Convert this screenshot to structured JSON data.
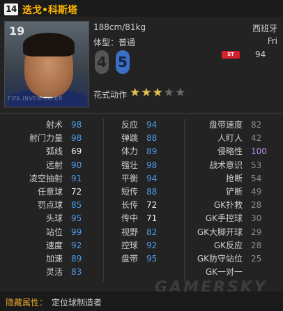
{
  "header": {
    "season_badge": "14",
    "player_name": "迭戈•科斯塔"
  },
  "portrait": {
    "overall": "19",
    "watermark": "FIFA.INVEN.CO.KR"
  },
  "info": {
    "height_weight": "188cm/81kg",
    "body_type": "体型：普通",
    "nation": "西班牙",
    "club": "Fri",
    "position_badge": "ST",
    "position_rating": "94",
    "weak_foot": "4",
    "strong_foot": "5",
    "skill_moves_label": "花式动作",
    "skill_stars": 3,
    "skill_stars_max": 5
  },
  "stats": {
    "col1": [
      {
        "name": "射术",
        "value": "98",
        "color": "blue"
      },
      {
        "name": "射门力量",
        "value": "98",
        "color": "blue"
      },
      {
        "name": "弧线",
        "value": "69",
        "color": "white"
      },
      {
        "name": "远射",
        "value": "90",
        "color": "blue"
      },
      {
        "name": "凌空抽射",
        "value": "91",
        "color": "blue"
      },
      {
        "name": "任意球",
        "value": "72",
        "color": "white"
      },
      {
        "name": "罚点球",
        "value": "85",
        "color": "blue"
      },
      {
        "name": "头球",
        "value": "95",
        "color": "blue"
      },
      {
        "name": "站位",
        "value": "99",
        "color": "blue"
      },
      {
        "name": "速度",
        "value": "92",
        "color": "blue"
      },
      {
        "name": "加速",
        "value": "89",
        "color": "blue"
      },
      {
        "name": "灵活",
        "value": "83",
        "color": "blue"
      }
    ],
    "col2": [
      {
        "name": "反应",
        "value": "94",
        "color": "blue"
      },
      {
        "name": "弹跳",
        "value": "88",
        "color": "blue"
      },
      {
        "name": "体力",
        "value": "89",
        "color": "blue"
      },
      {
        "name": "强壮",
        "value": "98",
        "color": "blue"
      },
      {
        "name": "平衡",
        "value": "94",
        "color": "blue"
      },
      {
        "name": "短传",
        "value": "88",
        "color": "blue"
      },
      {
        "name": "长传",
        "value": "72",
        "color": "white"
      },
      {
        "name": "传中",
        "value": "71",
        "color": "white"
      },
      {
        "name": "视野",
        "value": "82",
        "color": "blue"
      },
      {
        "name": "控球",
        "value": "92",
        "color": "blue"
      },
      {
        "name": "盘带",
        "value": "95",
        "color": "blue"
      }
    ],
    "col3": [
      {
        "name": "盘带速度",
        "value": "82",
        "color": "gray"
      },
      {
        "name": "人盯人",
        "value": "42",
        "color": "gray"
      },
      {
        "name": "侵略性",
        "value": "100",
        "color": "purple"
      },
      {
        "name": "战术意识",
        "value": "53",
        "color": "gray"
      },
      {
        "name": "抢断",
        "value": "54",
        "color": "gray"
      },
      {
        "name": "铲断",
        "value": "49",
        "color": "gray"
      },
      {
        "name": "GK扑救",
        "value": "28",
        "color": "gray"
      },
      {
        "name": "GK手控球",
        "value": "30",
        "color": "gray"
      },
      {
        "name": "GK大脚开球",
        "value": "29",
        "color": "gray"
      },
      {
        "name": "GK反应",
        "value": "28",
        "color": "gray"
      },
      {
        "name": "GK防守站位",
        "value": "25",
        "color": "gray"
      },
      {
        "name": "GK一对一",
        "value": "",
        "color": "gray"
      }
    ]
  },
  "hidden_attributes": {
    "label": "隐藏属性：",
    "value": "定位球制造者"
  },
  "brand_watermark": "GAMERSKY",
  "colors": {
    "accent": "#ffb400",
    "blue": "#4d9be6",
    "purple": "#b48ee8",
    "position_badge": "#d3212d"
  }
}
